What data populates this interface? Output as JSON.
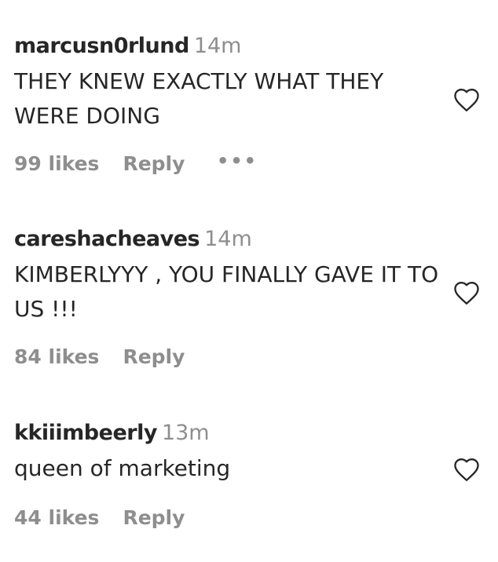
{
  "comments": [
    {
      "username": "marcusn0rlund",
      "time": "14m",
      "text": "THEY KNEW EXACTLY WHAT THEY WERE DOING",
      "likes": "99 likes",
      "reply": "Reply",
      "more": "•••"
    },
    {
      "username": "careshacheaves",
      "time": "14m",
      "text": "KIMBERLYYY , YOU FINALLY GAVE IT TO US !!!",
      "likes": "84 likes",
      "reply": "Reply"
    },
    {
      "username": "kkiiimbeerly",
      "time": "13m",
      "text": "queen of marketing",
      "likes": "44 likes",
      "reply": "Reply"
    }
  ],
  "icons": {
    "like": "heart-outline-icon",
    "options": "more-options-icon"
  },
  "colors": {
    "text": "#262626",
    "secondary": "#8e8e8e",
    "background": "#ffffff"
  }
}
